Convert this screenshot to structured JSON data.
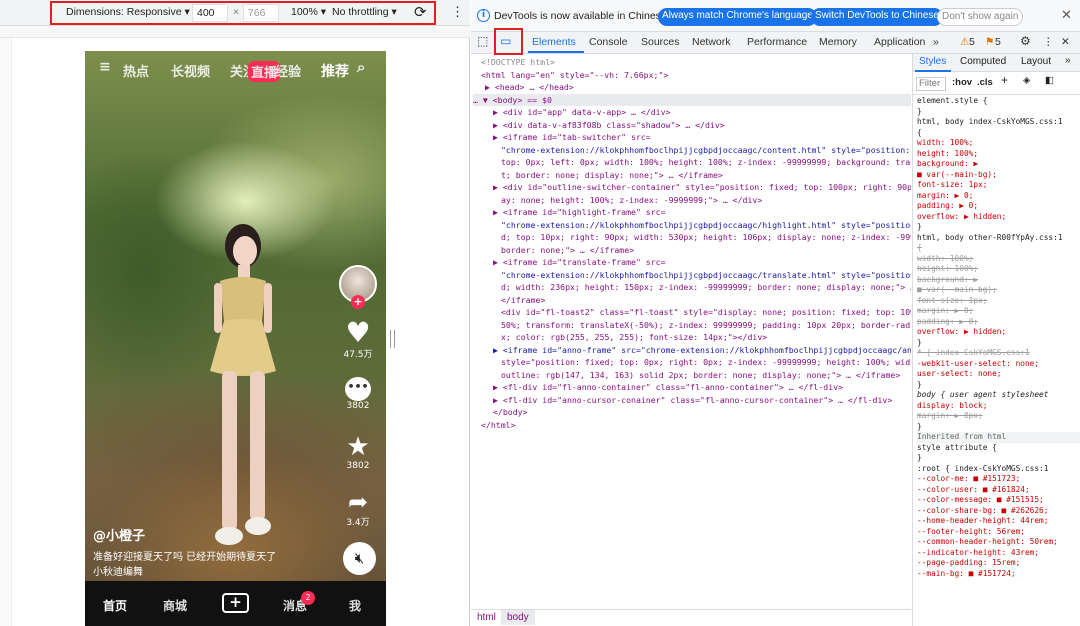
{
  "device_toolbar": {
    "dimensions": "Dimensions: Responsive",
    "width": "400",
    "times": "×",
    "height": "766",
    "zoom": "100%",
    "throttling": "No throttling"
  },
  "phone": {
    "nav": [
      "热点",
      "长视频",
      "关注",
      "经验",
      "推荐"
    ],
    "live_badge": "直播",
    "likes": "47.5万",
    "comments": "3802",
    "favorites": "3802",
    "shares": "3.4万",
    "author": "@小橙子",
    "caption_1": "准备好迎接夏天了吗 已经开始期待夏天了",
    "caption_2": "小秋迪编舞",
    "bottom_nav": [
      "首页",
      "商城",
      "+",
      "消息",
      "我"
    ],
    "msg_badge": "2"
  },
  "notice": {
    "text": "DevTools is now available in Chinese!",
    "btn_match": "Always match Chrome's language",
    "btn_switch": "Switch DevTools to Chinese",
    "btn_dont": "Don't show again"
  },
  "tabs": [
    "Elements",
    "Console",
    "Sources",
    "Network",
    "Performance",
    "Memory",
    "Application"
  ],
  "warnings": "5",
  "errors": "5",
  "styles_tabs": [
    "Styles",
    "Computed",
    "Layout"
  ],
  "filter_placeholder": "Filter",
  "hov": ":hov",
  "cls": ".cls",
  "breadcrumbs": [
    "html",
    "body"
  ],
  "dom_lines": [
    "<!DOCTYPE html>",
    "<html lang=\"en\" style=\"--vh: 7.66px;\">",
    "▶ <head> … </head>",
    "… ▼ <body> == $0",
    "▶ <div id=\"app\" data-v-app> … </div>",
    "▶ <div data-v-af83f08b class=\"shadow\"> … </div>",
    "▶ <iframe id=\"tab-switcher\" src=",
    "\"chrome-extension://klokphhomfboclhpijjcgbpdjoccaagc/content.html\" style=\"position: fixed;",
    "top: 0px; left: 0px; width: 100%; height: 100%; z-index: -99999999; background: transparen",
    "t; border: none; display: none;\"> … </iframe>",
    "▶ <div id=\"outline-switcher-container\" style=\"position: fixed; top: 100px; right: 90px; displ",
    "ay: none; height: 100%; z-index: -9999999;\"> … </div>",
    "▶ <iframe id=\"highlight-frame\" src=",
    "\"chrome-extension://klokphhomfboclhpijjcgbpdjoccaagc/highlight.html\" style=\"position: fixe",
    "d; top: 10px; right: 90px; width: 530px; height: 106px; display: none; z-index: -99999999;",
    "border: none;\"> … </iframe>",
    "▶ <iframe id=\"translate-frame\" src=",
    "\"chrome-extension://klokphhomfboclhpijjcgbpdjoccaagc/translate.html\" style=\"position: fixe",
    "d; width: 236px; height: 150px; z-index: -99999999; border: none; display: none;\"> …",
    "</iframe>",
    "<div id=\"fl-toast2\" class=\"fl-toast\" style=\"display: none; position: fixed; top: 10%; left:",
    "50%; transform: translateX(-50%); z-index: 99999999; padding: 10px 20px; border-radius: 5p",
    "x; color: rgb(255, 255, 255); font-size: 14px;\"></div>",
    "▶ <iframe id=\"anno-frame\" src=\"chrome-extension://klokphhomfboclhpijjcgbpdjoccaagc/anno.html\"",
    "style=\"position: fixed; top: 0px; right: 0px; z-index: -99999999; height: 100%; width: 34%;",
    "outline: rgb(147, 134, 163) solid 2px; border: none; display: none;\"> … </iframe>",
    "▶ <fl-div id=\"fl-anno-container\" class=\"fl-anno-container\"> … </fl-div>",
    "▶ <fl-div id=\"anno-cursor-conainer\" class=\"fl-anno-cursor-container\"> … </fl-div>",
    "</body>",
    "</html>"
  ],
  "style_lines": [
    "element.style {",
    "}",
    "html, body    index-CskYoMGS.css:1",
    "{",
    "  width: 100%;",
    "  height: 100%;",
    "  background: ▶",
    "    ■ var(--main-bg);",
    "  font-size: 1px;",
    "  margin: ▶ 0;",
    "  padding: ▶ 0;",
    "  overflow: ▶ hidden;",
    "}",
    "html, body    other-R00fYpAy.css:1",
    "{",
    "  width: 100%;",
    "  height: 100%;",
    "  background: ▶",
    "    ■ var(--main-bg);",
    "  font-size: 1px;",
    "  margin: ▶ 0;",
    "  padding: ▶ 0;",
    "  overflow: ▶ hidden;",
    "}",
    "* {           index-CskYoMGS.css:1",
    "  -webkit-user-select: none;",
    "  user-select: none;",
    "}",
    "body {      user agent stylesheet",
    "  display: block;",
    "  margin: ▶ 8px;",
    "}",
    "Inherited from html",
    "style attribute {",
    "}",
    ":root {      index-CskYoMGS.css:1",
    "  --color-me: ■ #151723;",
    "  --color-user: ■ #161824;",
    "  --color-message: ■ #151515;",
    "  --color-share-bg: ■ #262626;",
    "  --home-header-height: 44rem;",
    "  --footer-height: 56rem;",
    "  --common-header-height: 50rem;",
    "  --indicator-height: 43rem;",
    "  --page-padding: 15rem;",
    "  --main-bg: ■ #151724;"
  ]
}
